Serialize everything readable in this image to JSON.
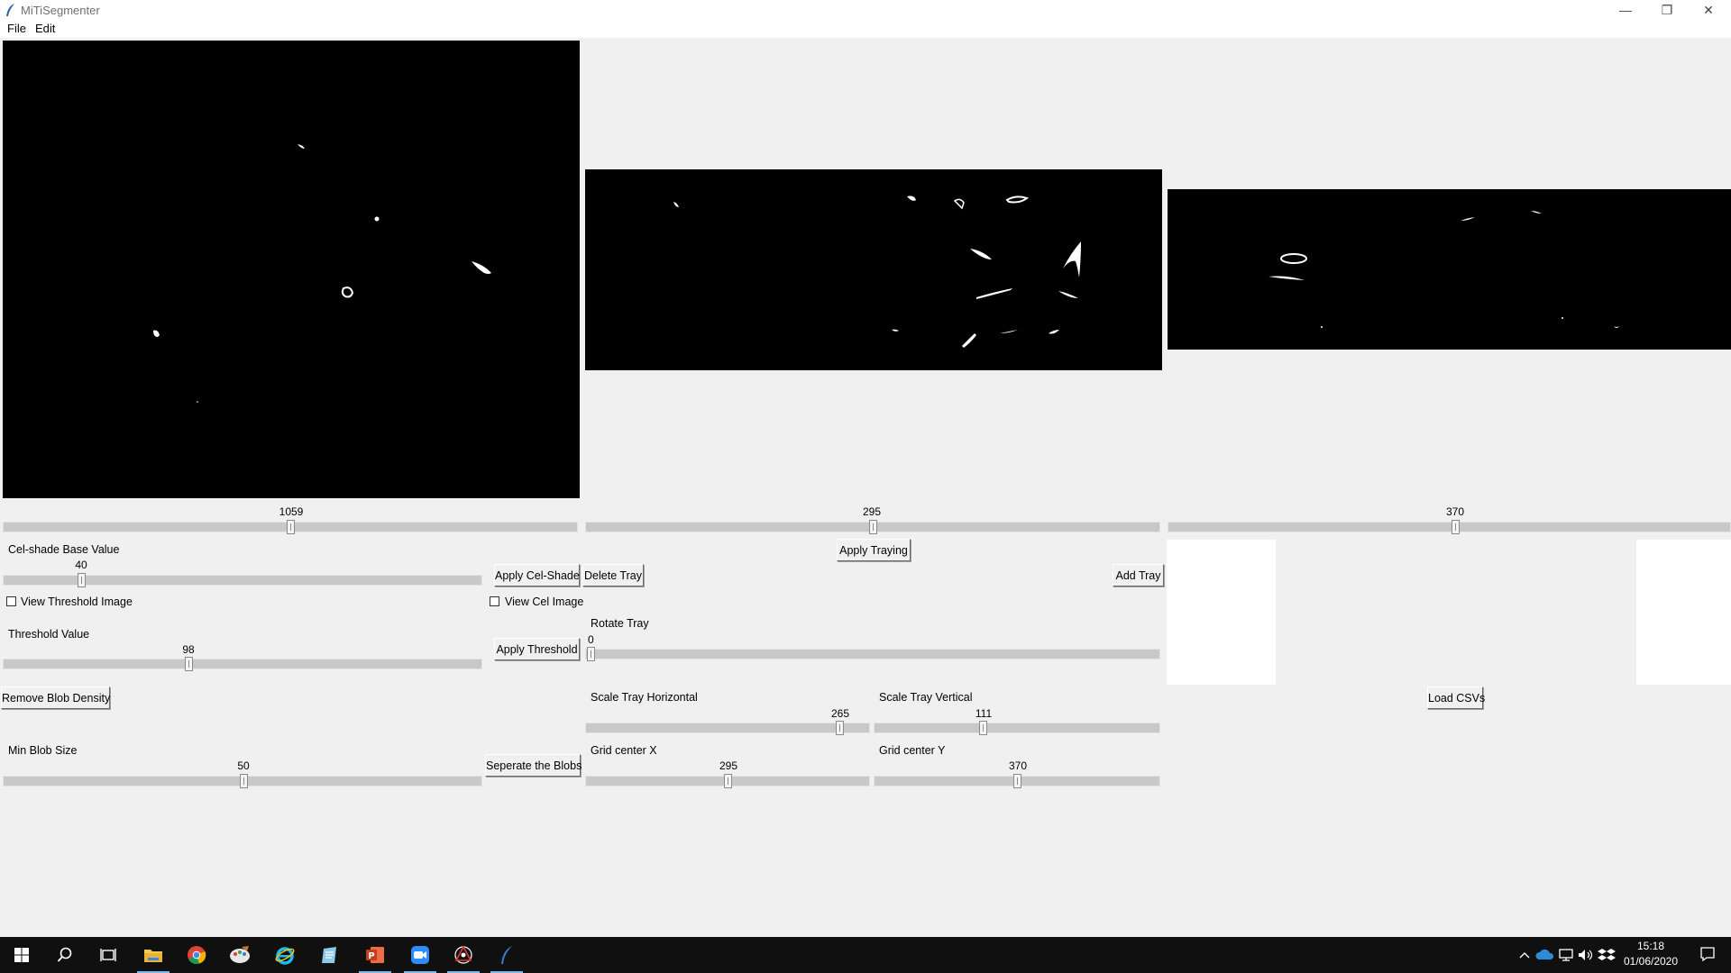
{
  "window": {
    "title": "MiTiSegmenter",
    "minimize": "—",
    "restore": "❐",
    "close": "✕"
  },
  "menu": {
    "file": "File",
    "edit": "Edit"
  },
  "sliders": {
    "image1_value": "1059",
    "image2_value": "295",
    "image3_value": "370",
    "celshade_value": "40",
    "threshold_value": "98",
    "rotate_value": "0",
    "scale_h_value": "265",
    "scale_v_value": "111",
    "min_blob_value": "50",
    "grid_x_value": "295",
    "grid_y_value": "370"
  },
  "labels": {
    "celshade_base": "Cel-shade Base Value",
    "view_threshold": "View Threshold Image",
    "threshold_value": "Threshold Value",
    "view_cel": "View Cel Image",
    "rotate_tray": "Rotate Tray",
    "scale_tray_h": "Scale Tray Horizontal",
    "scale_tray_v": "Scale Tray Vertical",
    "min_blob_size": "Min Blob Size",
    "grid_center_x": "Grid center X",
    "grid_center_y": "Grid center Y"
  },
  "buttons": {
    "apply_traying": "Apply Traying",
    "apply_celshade": "Apply Cel-Shade",
    "delete_tray": "Delete Tray",
    "add_tray": "Add Tray",
    "apply_threshold": "Apply Threshold",
    "remove_blob_density": "Remove Blob Density",
    "load_csvs": "Load CSVs",
    "separate_blobs": "Seperate the Blobs"
  },
  "taskbar": {
    "time": "15:18",
    "date": "01/06/2020",
    "icons": [
      "windows-start-icon",
      "search-icon",
      "task-view-icon",
      "file-explorer-icon",
      "chrome-icon",
      "paint-icon",
      "internet-explorer-icon",
      "notepad-icon",
      "powerpoint-icon",
      "zoom-icon",
      "spider-app-icon",
      "python-feather-icon"
    ]
  },
  "colors": {
    "accent": "#76b9ed",
    "taskbar": "#101010",
    "background": "#f0f0f0"
  }
}
